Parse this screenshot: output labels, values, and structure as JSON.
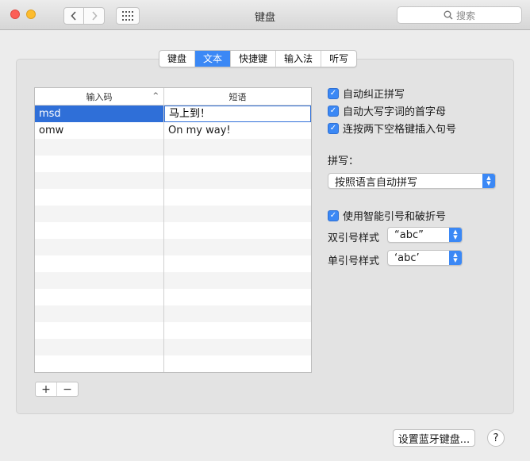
{
  "window": {
    "title": "键盘"
  },
  "search": {
    "placeholder": "搜索"
  },
  "tabs": [
    {
      "label": "键盘",
      "active": false
    },
    {
      "label": "文本",
      "active": true
    },
    {
      "label": "快捷键",
      "active": false
    },
    {
      "label": "输入法",
      "active": false
    },
    {
      "label": "听写",
      "active": false
    }
  ],
  "table": {
    "columns": [
      "输入码",
      "短语"
    ],
    "rows": [
      {
        "code": "msd",
        "phrase": "马上到！",
        "selected": true
      },
      {
        "code": "omw",
        "phrase": "On my way!",
        "selected": false
      }
    ]
  },
  "controls": {
    "add": "+",
    "remove": "−"
  },
  "options": {
    "auto_correct": "自动纠正拼写",
    "auto_capitalize": "自动大写字词的首字母",
    "double_space_period": "连按两下空格键插入句号",
    "spelling_label": "拼写：",
    "spelling_value": "按照语言自动拼写",
    "smart_quotes": "使用智能引号和破折号",
    "double_quote_label": "双引号样式",
    "double_quote_value": "“abc”",
    "single_quote_label": "单引号样式",
    "single_quote_value": "‘abc’"
  },
  "footer": {
    "bluetooth_button": "设置蓝牙键盘...",
    "help_button": "?"
  },
  "colors": {
    "accent": "#3b88f5",
    "selection": "#2f6fd8"
  }
}
